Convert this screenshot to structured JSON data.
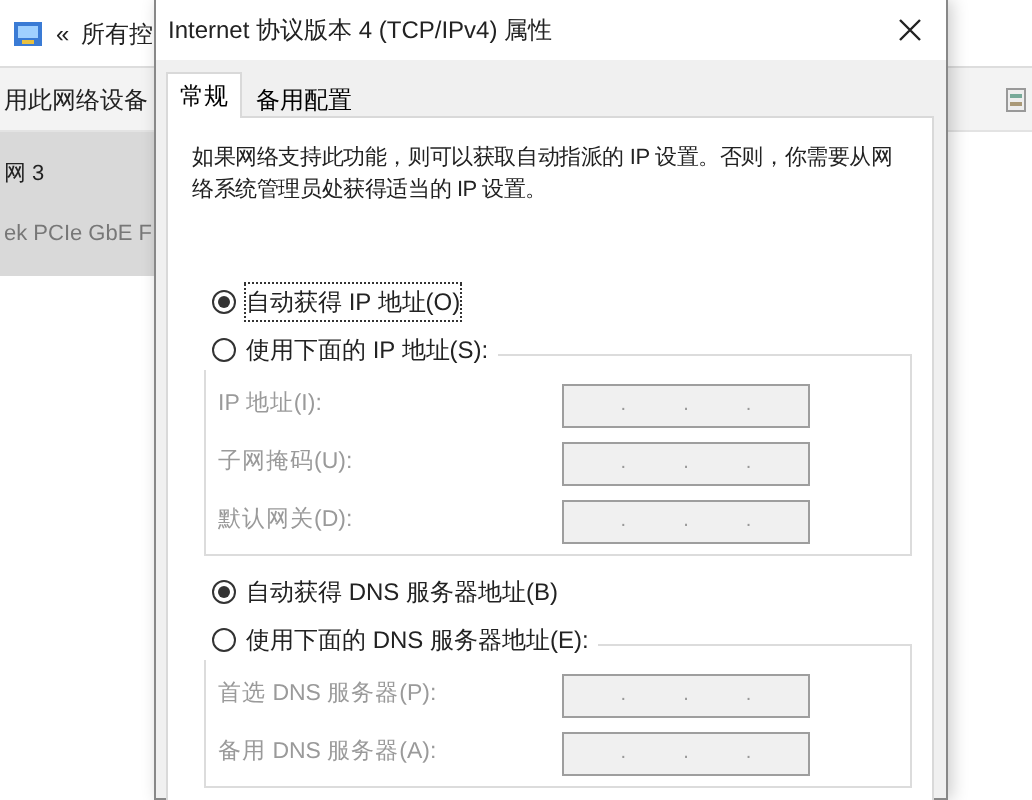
{
  "background_window": {
    "back_symbol": "«",
    "breadcrumb": "所有控",
    "toolbar_item": "用此网络设备",
    "connections": [
      {
        "name": "网 3",
        "device": "ek PCIe GbE F",
        "selected": true
      }
    ]
  },
  "dialog": {
    "title": "Internet 协议版本 4 (TCP/IPv4) 属性",
    "tabs": [
      {
        "label": "常规",
        "selected": true
      },
      {
        "label": "备用配置",
        "selected": false
      }
    ],
    "description": "如果网络支持此功能，则可以获取自动指派的 IP 设置。否则，你需要从网络系统管理员处获得适当的 IP 设置。",
    "sections": [
      {
        "options": [
          {
            "label": "自动获得 IP 地址(O)",
            "selected": true,
            "focused": true
          },
          {
            "label": "使用下面的 IP 地址(S):",
            "selected": false,
            "focused": false
          }
        ],
        "fields": [
          {
            "label": "IP 地址(I):",
            "separators": [
              ".",
              ".",
              "."
            ],
            "disabled": true
          },
          {
            "label": "子网掩码(U):",
            "separators": [
              ".",
              ".",
              "."
            ],
            "disabled": true
          },
          {
            "label": "默认网关(D):",
            "separators": [
              ".",
              ".",
              "."
            ],
            "disabled": true
          }
        ]
      },
      {
        "options": [
          {
            "label": "自动获得 DNS 服务器地址(B)",
            "selected": true,
            "focused": false
          },
          {
            "label": "使用下面的 DNS 服务器地址(E):",
            "selected": false,
            "focused": false
          }
        ],
        "fields": [
          {
            "label": "首选 DNS 服务器(P):",
            "separators": [
              ".",
              ".",
              "."
            ],
            "disabled": true
          },
          {
            "label": "备用 DNS 服务器(A):",
            "separators": [
              ".",
              ".",
              "."
            ],
            "disabled": true
          }
        ]
      }
    ]
  }
}
